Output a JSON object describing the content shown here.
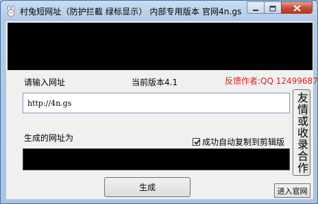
{
  "window": {
    "title": "村兔短网址（防护拦截 绿标显示） 内部专用版本 官网4n.gs"
  },
  "labels": {
    "input_url": "请输入网址",
    "version": "当前版本4.1",
    "feedback": "反馈作者:QQ 12499687",
    "output_url": "生成的网址为"
  },
  "url_input": {
    "value": "http://4n.gs"
  },
  "side_button": {
    "label": "友情或收录合作"
  },
  "auto_copy": {
    "label": "成功自动复制到剪辑版",
    "checked": true
  },
  "buttons": {
    "generate": "生成",
    "enter_site": "进入官网"
  },
  "colors": {
    "feedback": "#e0191a",
    "banner": "#000000"
  }
}
